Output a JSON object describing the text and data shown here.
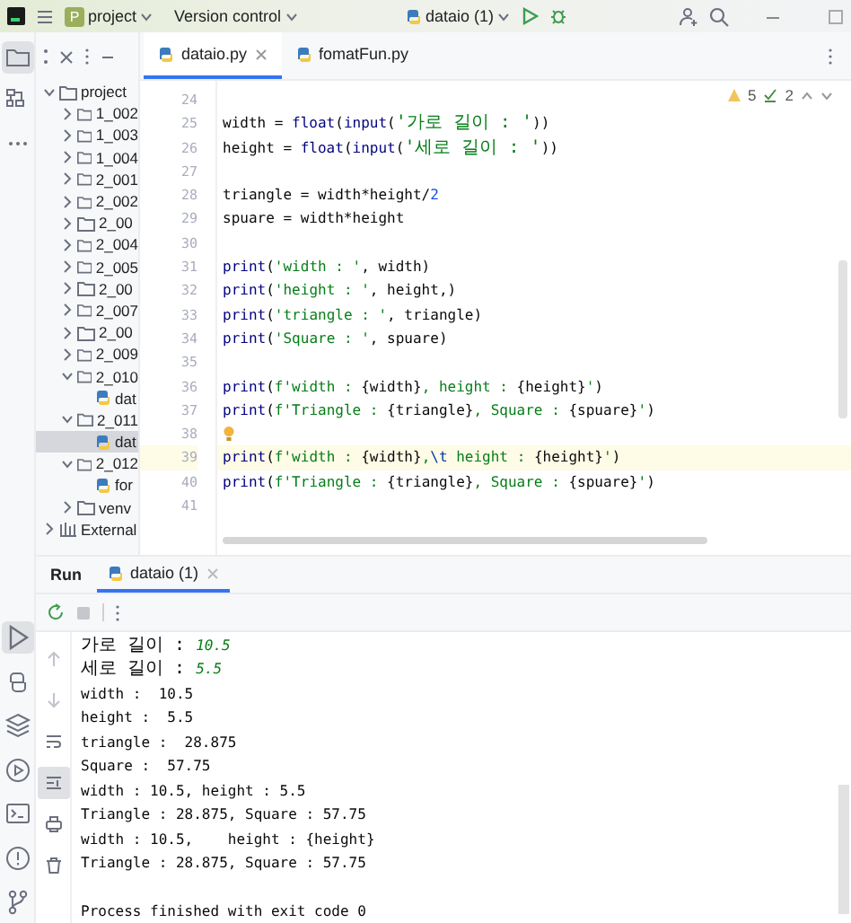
{
  "title_bar": {
    "project_badge": "P",
    "project": "project",
    "vcs": "Version control",
    "run_config": "dataio (1)"
  },
  "tool_strip": {
    "top": [
      {
        "selected": true
      },
      {
        "selected": false
      },
      {
        "selected": false
      }
    ],
    "bottom": [
      {
        "selected": true
      },
      {
        "selected": false
      },
      {
        "selected": false
      },
      {
        "selected": false
      },
      {
        "selected": false
      },
      {
        "selected": false
      },
      {
        "selected": false
      }
    ]
  },
  "project_tree": [
    {
      "label": "project",
      "kind": "folder",
      "expanded": true,
      "selected": false,
      "children": [
        {
          "label": "1_002",
          "kind": "folder",
          "expanded": false,
          "selected": false
        },
        {
          "label": "1_003",
          "kind": "folder",
          "expanded": false,
          "selected": false
        },
        {
          "label": "1_004",
          "kind": "folder",
          "expanded": false,
          "selected": false
        },
        {
          "label": "2_001",
          "kind": "folder",
          "expanded": false,
          "selected": false
        },
        {
          "label": "2_002",
          "kind": "folder",
          "expanded": false,
          "selected": false
        },
        {
          "label": "2_00",
          "kind": "folder",
          "expanded": false,
          "selected": false
        },
        {
          "label": "2_004",
          "kind": "folder",
          "expanded": false,
          "selected": false
        },
        {
          "label": "2_005",
          "kind": "folder",
          "expanded": false,
          "selected": false
        },
        {
          "label": "2_00",
          "kind": "folder",
          "expanded": false,
          "selected": false
        },
        {
          "label": "2_007",
          "kind": "folder",
          "expanded": false,
          "selected": false
        },
        {
          "label": "2_00",
          "kind": "folder",
          "expanded": false,
          "selected": false
        },
        {
          "label": "2_009",
          "kind": "folder",
          "expanded": false,
          "selected": false
        },
        {
          "label": "2_010",
          "kind": "folder",
          "expanded": true,
          "selected": false,
          "children": [
            {
              "label": "dat",
              "kind": "python",
              "selected": false
            }
          ]
        },
        {
          "label": "2_011",
          "kind": "folder",
          "expanded": true,
          "selected": false,
          "children": [
            {
              "label": "dat",
              "kind": "python",
              "selected": true
            }
          ]
        },
        {
          "label": "2_012",
          "kind": "folder",
          "expanded": true,
          "selected": false,
          "children": [
            {
              "label": "for",
              "kind": "python",
              "selected": false
            }
          ]
        },
        {
          "label": "venv",
          "kind": "folder",
          "expanded": false,
          "selected": false
        }
      ]
    },
    {
      "label": "External",
      "kind": "library",
      "expanded": false,
      "selected": false
    }
  ],
  "editor_tabs": [
    {
      "label": "dataio.py",
      "selected": true
    },
    {
      "label": "fomatFun.py",
      "selected": false
    }
  ],
  "inspections": {
    "warnings": "5",
    "checks": "2"
  },
  "code_lines": [
    {
      "number": "24",
      "current": false,
      "bulb": false
    },
    {
      "number": "25",
      "current": false,
      "bulb": false,
      "segments": [
        {
          "text": "width = ",
          "kind": "plain"
        },
        {
          "text": "float",
          "kind": "builtin"
        },
        {
          "text": "(",
          "kind": "plain"
        },
        {
          "text": "input",
          "kind": "builtin"
        },
        {
          "text": "(",
          "kind": "plain"
        },
        {
          "text": "'가로 길이 : '",
          "kind": "string"
        },
        {
          "text": "))",
          "kind": "plain"
        }
      ]
    },
    {
      "number": "26",
      "current": false,
      "bulb": false,
      "segments": [
        {
          "text": "height = ",
          "kind": "plain"
        },
        {
          "text": "float",
          "kind": "builtin"
        },
        {
          "text": "(",
          "kind": "plain"
        },
        {
          "text": "input",
          "kind": "builtin"
        },
        {
          "text": "(",
          "kind": "plain"
        },
        {
          "text": "'세로 길이 : '",
          "kind": "string"
        },
        {
          "text": "))",
          "kind": "plain"
        }
      ]
    },
    {
      "number": "27",
      "current": false,
      "bulb": false
    },
    {
      "number": "28",
      "current": false,
      "bulb": false,
      "segments": [
        {
          "text": "triangle = width*height/",
          "kind": "plain"
        },
        {
          "text": "2",
          "kind": "number"
        }
      ]
    },
    {
      "number": "29",
      "current": false,
      "bulb": false,
      "segments": [
        {
          "text": "spuare = width*height",
          "kind": "plain"
        }
      ]
    },
    {
      "number": "30",
      "current": false,
      "bulb": false
    },
    {
      "number": "31",
      "current": false,
      "bulb": false,
      "segments": [
        {
          "text": "print",
          "kind": "builtin"
        },
        {
          "text": "(",
          "kind": "plain"
        },
        {
          "text": "'width : '",
          "kind": "string"
        },
        {
          "text": ", width)",
          "kind": "plain"
        }
      ]
    },
    {
      "number": "32",
      "current": false,
      "bulb": false,
      "segments": [
        {
          "text": "print",
          "kind": "builtin"
        },
        {
          "text": "(",
          "kind": "plain"
        },
        {
          "text": "'height : '",
          "kind": "string"
        },
        {
          "text": ", height,)",
          "kind": "plain"
        }
      ]
    },
    {
      "number": "33",
      "current": false,
      "bulb": false,
      "segments": [
        {
          "text": "print",
          "kind": "builtin"
        },
        {
          "text": "(",
          "kind": "plain"
        },
        {
          "text": "'triangle : '",
          "kind": "string"
        },
        {
          "text": ", triangle)",
          "kind": "plain"
        }
      ]
    },
    {
      "number": "34",
      "current": false,
      "bulb": false,
      "segments": [
        {
          "text": "print",
          "kind": "builtin"
        },
        {
          "text": "(",
          "kind": "plain"
        },
        {
          "text": "'Square : '",
          "kind": "string"
        },
        {
          "text": ", spuare)",
          "kind": "plain"
        }
      ]
    },
    {
      "number": "35",
      "current": false,
      "bulb": false
    },
    {
      "number": "36",
      "current": false,
      "bulb": false,
      "segments": [
        {
          "text": "print",
          "kind": "builtin"
        },
        {
          "text": "(",
          "kind": "plain"
        },
        {
          "text": "f'width : ",
          "kind": "string"
        },
        {
          "text": "{width}",
          "kind": "plain"
        },
        {
          "text": ", height : ",
          "kind": "string"
        },
        {
          "text": "{height}",
          "kind": "plain"
        },
        {
          "text": "'",
          "kind": "string"
        },
        {
          "text": ")",
          "kind": "plain"
        }
      ]
    },
    {
      "number": "37",
      "current": false,
      "bulb": false,
      "segments": [
        {
          "text": "print",
          "kind": "builtin"
        },
        {
          "text": "(",
          "kind": "plain"
        },
        {
          "text": "f'Triangle : ",
          "kind": "string"
        },
        {
          "text": "{triangle}",
          "kind": "plain"
        },
        {
          "text": ", Square : ",
          "kind": "string"
        },
        {
          "text": "{spuare}",
          "kind": "plain"
        },
        {
          "text": "'",
          "kind": "string"
        },
        {
          "text": ")",
          "kind": "plain"
        }
      ]
    },
    {
      "number": "38",
      "current": false,
      "bulb": true
    },
    {
      "number": "39",
      "current": true,
      "bulb": false,
      "segments": [
        {
          "text": "print",
          "kind": "builtin"
        },
        {
          "text": "(",
          "kind": "plain"
        },
        {
          "text": "f'width : ",
          "kind": "string"
        },
        {
          "text": "{width}",
          "kind": "plain"
        },
        {
          "text": ",",
          "kind": "string"
        },
        {
          "text": "\\t",
          "kind": "escape"
        },
        {
          "text": " height : ",
          "kind": "string"
        },
        {
          "text": "{height}",
          "kind": "plain"
        },
        {
          "text": "'",
          "kind": "string"
        },
        {
          "text": ")",
          "kind": "plain"
        }
      ]
    },
    {
      "number": "40",
      "current": false,
      "bulb": false,
      "segments": [
        {
          "text": "print",
          "kind": "builtin"
        },
        {
          "text": "(",
          "kind": "plain"
        },
        {
          "text": "f'Triangle : ",
          "kind": "string"
        },
        {
          "text": "{triangle}",
          "kind": "plain"
        },
        {
          "text": ", Square : ",
          "kind": "string"
        },
        {
          "text": "{spuare}",
          "kind": "plain"
        },
        {
          "text": "'",
          "kind": "string"
        },
        {
          "text": ")",
          "kind": "plain"
        }
      ]
    },
    {
      "number": "41",
      "current": false,
      "bulb": false
    }
  ],
  "run_panel": {
    "title": "Run",
    "tabs": [
      {
        "label": "dataio (1)",
        "selected": true
      }
    ],
    "side_tools": [
      {
        "selected": false
      },
      {
        "selected": false
      },
      {
        "selected": false
      },
      {
        "selected": true
      },
      {
        "selected": false
      },
      {
        "selected": false
      }
    ],
    "output": [
      {
        "kind": "plain",
        "segments": [
          {
            "text": "가로 길이 : ",
            "kind": "plain"
          },
          {
            "text": "10.5",
            "kind": "input"
          }
        ]
      },
      {
        "kind": "plain",
        "segments": [
          {
            "text": "세로 길이 : ",
            "kind": "plain"
          },
          {
            "text": "5.5",
            "kind": "input"
          }
        ]
      },
      {
        "kind": "plain",
        "segments": [
          {
            "text": "width :  10.5",
            "kind": "plain"
          }
        ]
      },
      {
        "kind": "plain",
        "segments": [
          {
            "text": "height :  5.5",
            "kind": "plain"
          }
        ]
      },
      {
        "kind": "plain",
        "segments": [
          {
            "text": "triangle :  28.875",
            "kind": "plain"
          }
        ]
      },
      {
        "kind": "plain",
        "segments": [
          {
            "text": "Square :  57.75",
            "kind": "plain"
          }
        ]
      },
      {
        "kind": "plain",
        "segments": [
          {
            "text": "width : 10.5, height : 5.5",
            "kind": "plain"
          }
        ]
      },
      {
        "kind": "plain",
        "segments": [
          {
            "text": "Triangle : 28.875, Square : 57.75",
            "kind": "plain"
          }
        ]
      },
      {
        "kind": "plain",
        "segments": [
          {
            "text": "width : 10.5,    height : {height}",
            "kind": "plain"
          }
        ]
      },
      {
        "kind": "plain",
        "segments": [
          {
            "text": "Triangle : 28.875, Square : 57.75",
            "kind": "plain"
          }
        ]
      },
      {
        "kind": "exit",
        "segments": [
          {
            "text": "Process finished with exit code 0",
            "kind": "plain"
          }
        ]
      }
    ]
  }
}
